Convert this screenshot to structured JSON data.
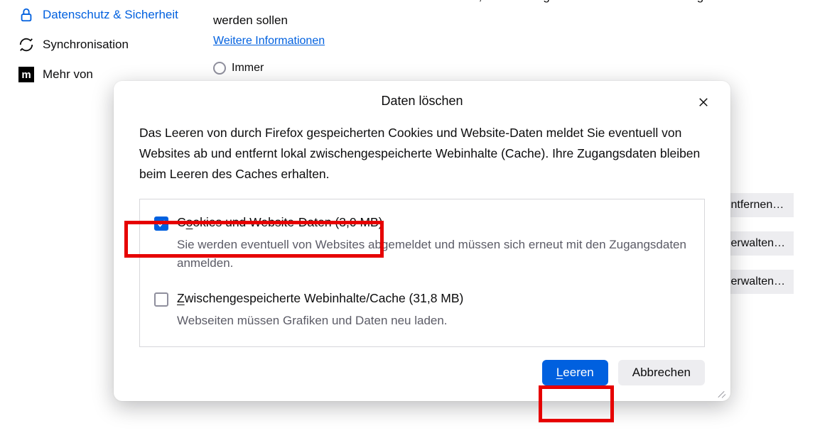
{
  "sidebar": {
    "items": [
      {
        "label": "Datenschutz & Sicherheit"
      },
      {
        "label": "Synchronisation"
      },
      {
        "label": "Mehr von"
      }
    ]
  },
  "main": {
    "tracking_line1": "Websites eine \"Do Not Track\"-Information senden, dass die eigenen Aktivitäten nicht verfolgt",
    "tracking_line2": "werden sollen",
    "more_info": "Weitere Informationen",
    "radio_always": "Immer"
  },
  "bg_buttons": {
    "remove": "ntfernen…",
    "manage1": "erwalten…",
    "manage2": "erwalten…"
  },
  "dialog": {
    "title": "Daten löschen",
    "intro": "Das Leeren von durch Firefox gespeicherten Cookies und Website-Daten meldet Sie eventuell von Websites ab und entfernt lokal zwischengespeicherte Webinhalte (Cache). Ihre Zugangsdaten bleiben beim Leeren des Caches erhalten.",
    "opt1": {
      "title_pre": "C",
      "title_ul": "o",
      "title_post": "okies und Website-Daten (3,0 MB)",
      "desc": "Sie werden eventuell von Websites abgemeldet und müssen sich erneut mit den Zugangsdaten anmelden.",
      "checked": true
    },
    "opt2": {
      "title_pre": "",
      "title_ul": "Z",
      "title_post": "wischengespeicherte Webinhalte/Cache (31,8 MB)",
      "desc": "Webseiten müssen Grafiken und Daten neu laden.",
      "checked": false
    },
    "clear_ul": "L",
    "clear_post": "eeren",
    "cancel": "Abbrechen"
  }
}
